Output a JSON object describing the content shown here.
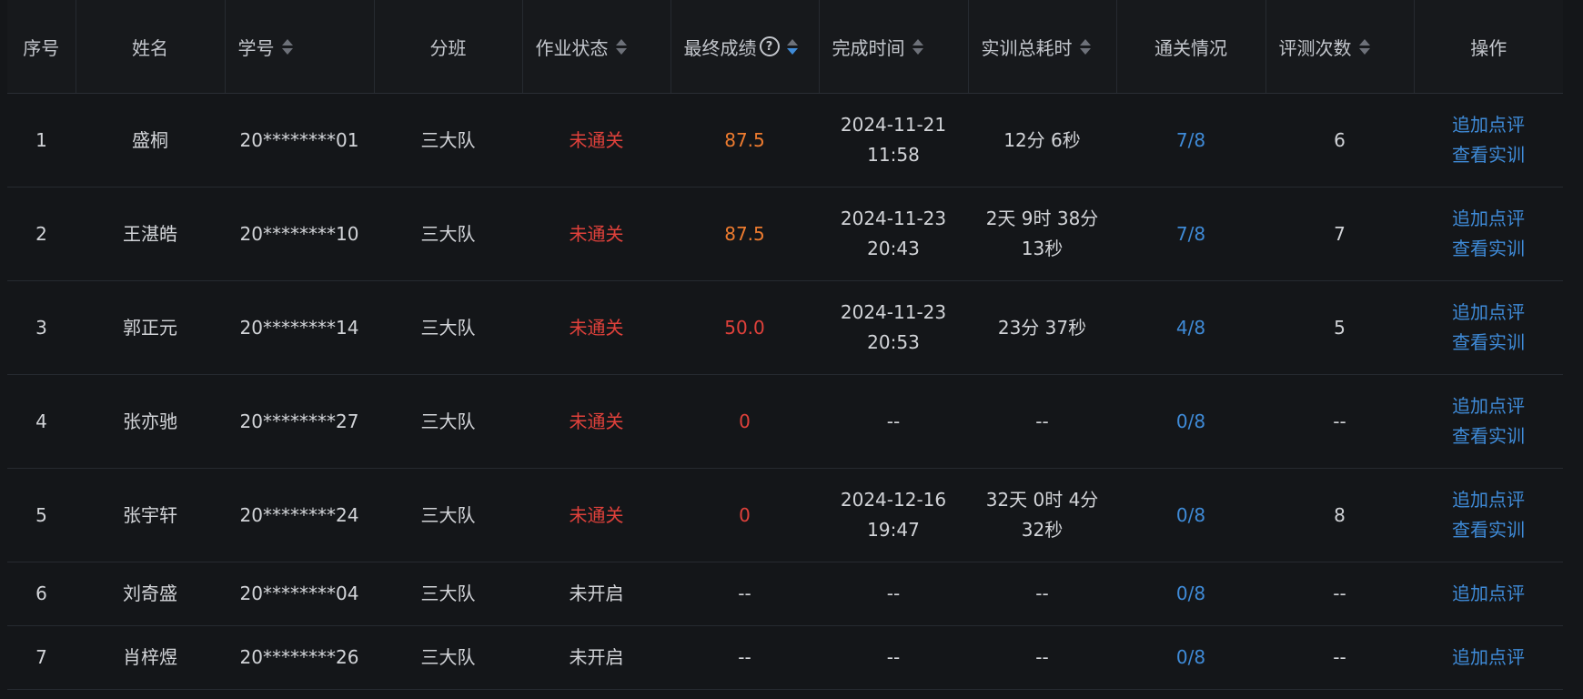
{
  "columns": [
    {
      "key": "index",
      "label": "序号",
      "sortable": false
    },
    {
      "key": "name",
      "label": "姓名",
      "sortable": false
    },
    {
      "key": "student_id",
      "label": "学号",
      "sortable": true
    },
    {
      "key": "class",
      "label": "分班",
      "sortable": false
    },
    {
      "key": "status",
      "label": "作业状态",
      "sortable": true
    },
    {
      "key": "score",
      "label": "最终成绩",
      "sortable": true,
      "help": "?",
      "sort_active": "desc"
    },
    {
      "key": "finish_time",
      "label": "完成时间",
      "sortable": true
    },
    {
      "key": "duration",
      "label": "实训总耗时",
      "sortable": true
    },
    {
      "key": "pass",
      "label": "通关情况",
      "sortable": false
    },
    {
      "key": "evals",
      "label": "评测次数",
      "sortable": true
    },
    {
      "key": "ops",
      "label": "操作",
      "sortable": false
    }
  ],
  "actions": {
    "add_comment": "追加点评",
    "view_training": "查看实训"
  },
  "colors": {
    "background": "#141619",
    "fail": "#e0413b",
    "score_orange": "#ed7b2f",
    "link": "#3f8bd8"
  },
  "rows": [
    {
      "index": "1",
      "name": "盛桐",
      "student_id": "20********01",
      "class": "三大队",
      "status": "未通关",
      "status_type": "fail",
      "score": "87.5",
      "score_type": "orange",
      "finish_time": [
        "2024-11-21",
        "11:58"
      ],
      "duration": [
        "12分 6秒"
      ],
      "pass": "7/8",
      "evals": "6",
      "view": true
    },
    {
      "index": "2",
      "name": "王湛皓",
      "student_id": "20********10",
      "class": "三大队",
      "status": "未通关",
      "status_type": "fail",
      "score": "87.5",
      "score_type": "orange",
      "finish_time": [
        "2024-11-23",
        "20:43"
      ],
      "duration": [
        "2天 9时 38分",
        "13秒"
      ],
      "pass": "7/8",
      "evals": "7",
      "view": true
    },
    {
      "index": "3",
      "name": "郭正元",
      "student_id": "20********14",
      "class": "三大队",
      "status": "未通关",
      "status_type": "fail",
      "score": "50.0",
      "score_type": "red",
      "finish_time": [
        "2024-11-23",
        "20:53"
      ],
      "duration": [
        "23分 37秒"
      ],
      "pass": "4/8",
      "evals": "5",
      "view": true
    },
    {
      "index": "4",
      "name": "张亦驰",
      "student_id": "20********27",
      "class": "三大队",
      "status": "未通关",
      "status_type": "fail",
      "score": "0",
      "score_type": "red",
      "finish_time": [
        "--"
      ],
      "duration": [
        "--"
      ],
      "pass": "0/8",
      "evals": "--",
      "view": true
    },
    {
      "index": "5",
      "name": "张宇轩",
      "student_id": "20********24",
      "class": "三大队",
      "status": "未通关",
      "status_type": "fail",
      "score": "0",
      "score_type": "red",
      "finish_time": [
        "2024-12-16",
        "19:47"
      ],
      "duration": [
        "32天 0时 4分",
        "32秒"
      ],
      "pass": "0/8",
      "evals": "8",
      "view": true
    },
    {
      "index": "6",
      "name": "刘奇盛",
      "student_id": "20********04",
      "class": "三大队",
      "status": "未开启",
      "status_type": "normal",
      "score": "--",
      "score_type": "normal",
      "finish_time": [
        "--"
      ],
      "duration": [
        "--"
      ],
      "pass": "0/8",
      "evals": "--",
      "view": false
    },
    {
      "index": "7",
      "name": "肖梓煜",
      "student_id": "20********26",
      "class": "三大队",
      "status": "未开启",
      "status_type": "normal",
      "score": "--",
      "score_type": "normal",
      "finish_time": [
        "--"
      ],
      "duration": [
        "--"
      ],
      "pass": "0/8",
      "evals": "--",
      "view": false
    }
  ]
}
